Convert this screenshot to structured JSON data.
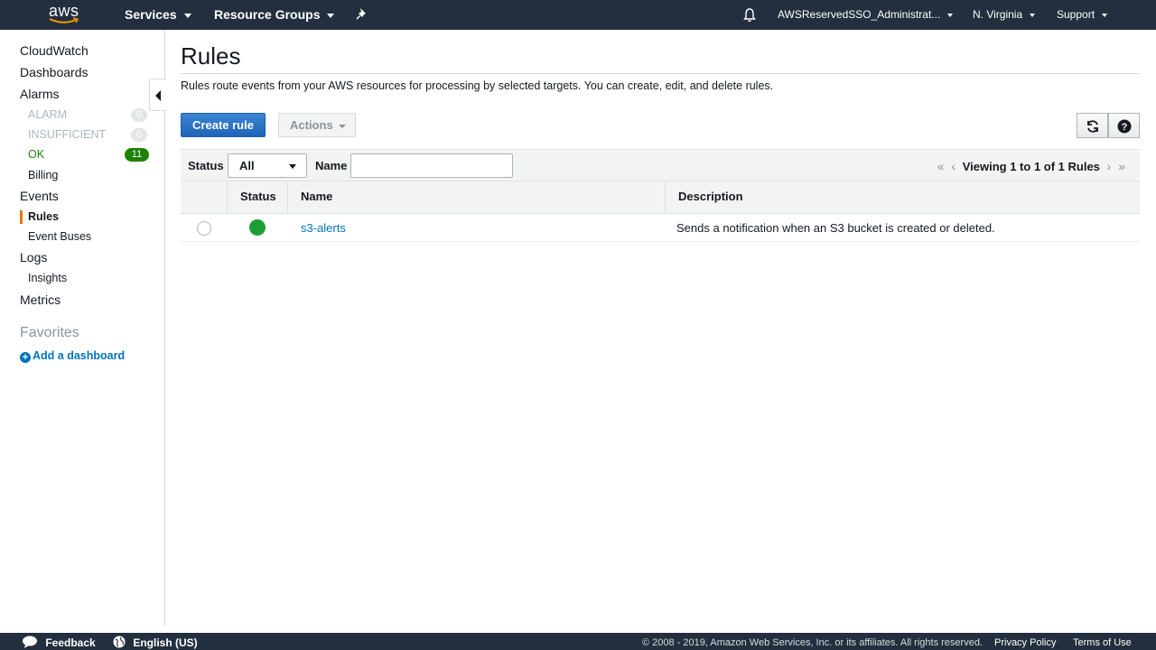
{
  "topnav": {
    "logo_text": "aws",
    "services": "Services",
    "resource_groups": "Resource Groups",
    "account": "AWSReservedSSO_Administrat...",
    "region": "N. Virginia",
    "support": "Support"
  },
  "sidebar": {
    "cloudwatch": "CloudWatch",
    "dashboards": "Dashboards",
    "alarms": "Alarms",
    "alarm": {
      "label": "ALARM",
      "count": "0"
    },
    "insufficient": {
      "label": "INSUFFICIENT",
      "count": "0"
    },
    "ok": {
      "label": "OK",
      "count": "11"
    },
    "billing": "Billing",
    "events": "Events",
    "rules": "Rules",
    "event_buses": "Event Buses",
    "logs": "Logs",
    "insights": "Insights",
    "metrics": "Metrics",
    "favorites": "Favorites",
    "add_dashboard": "Add a dashboard"
  },
  "main": {
    "title": "Rules",
    "description": "Rules route events from your AWS resources for processing by selected targets. You can create, edit, and delete rules.",
    "create_rule": "Create rule",
    "actions": "Actions",
    "filter": {
      "status_label": "Status",
      "status_value": "All",
      "name_label": "Name",
      "name_value": ""
    },
    "pager": "Viewing 1 to 1 of 1 Rules",
    "table": {
      "headers": [
        "Status",
        "Name",
        "Description"
      ],
      "rows": [
        {
          "status": "enabled",
          "name": "s3-alerts",
          "description": "Sends a notification when an S3 bucket is created or deleted."
        }
      ]
    }
  },
  "footer": {
    "feedback": "Feedback",
    "language": "English (US)",
    "copyright": "© 2008 - 2019, Amazon Web Services, Inc. or its affiliates. All rights reserved.",
    "privacy": "Privacy Policy",
    "terms": "Terms of Use"
  },
  "colors": {
    "nav_bg": "#232f3e",
    "link": "#0073bb",
    "ok_green": "#1d8102",
    "accent_orange": "#ec7211",
    "status_green": "#1d9e35"
  }
}
